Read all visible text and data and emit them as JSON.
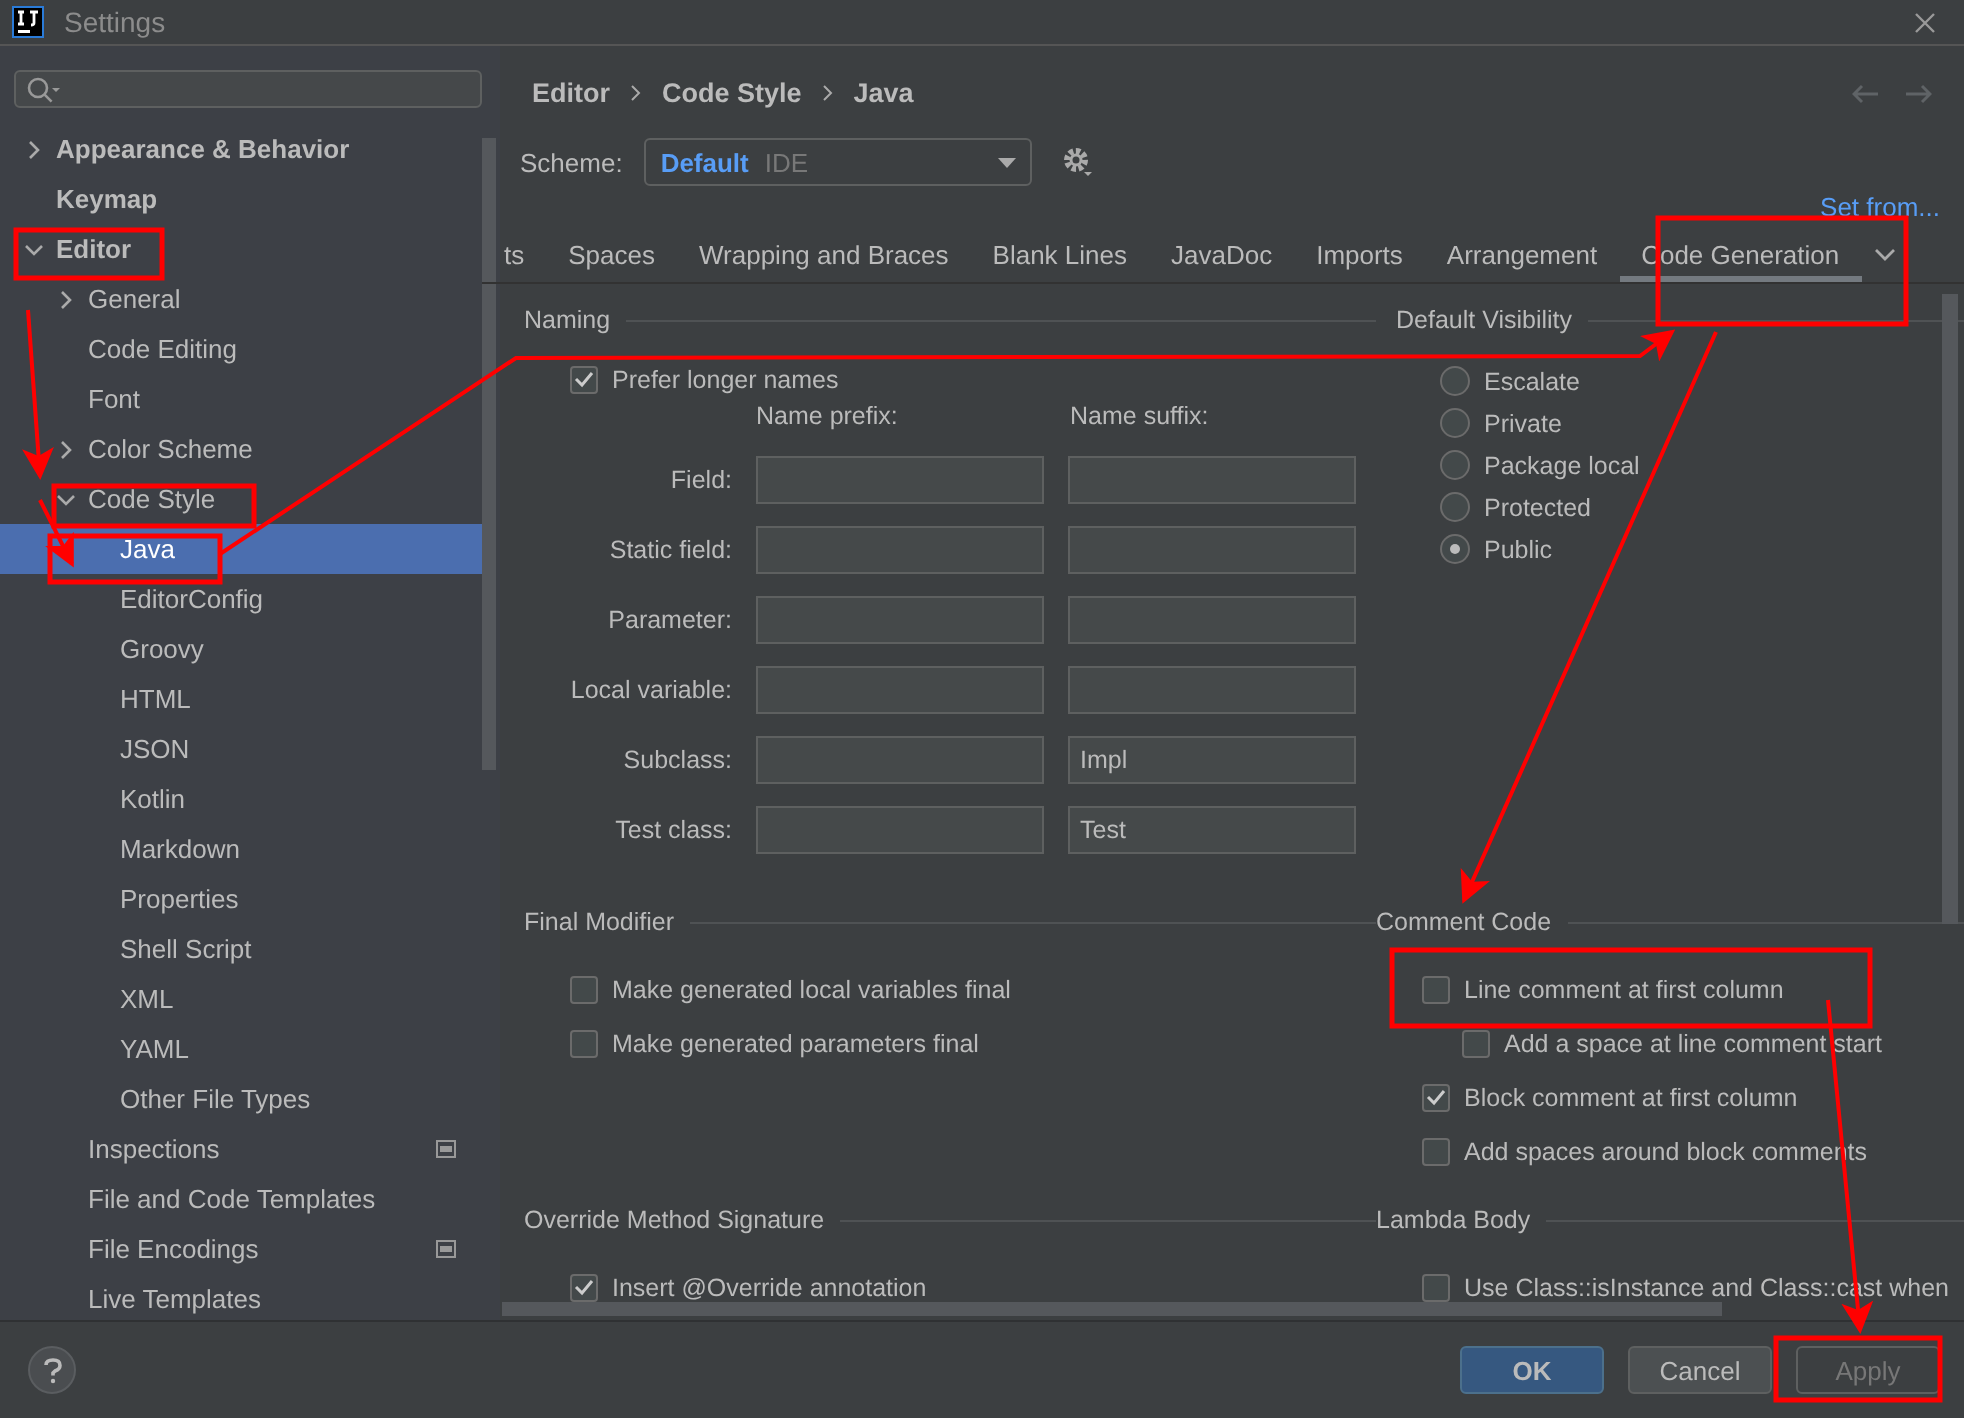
{
  "window": {
    "title": "Settings"
  },
  "sidebar": {
    "items": [
      {
        "label": "Appearance & Behavior",
        "bold": true,
        "expanded": false,
        "selected": false
      },
      {
        "label": "Keymap",
        "bold": true,
        "selected": false
      },
      {
        "label": "Editor",
        "bold": true,
        "expanded": true,
        "selected": false,
        "children": [
          {
            "label": "General",
            "expanded": false,
            "selected": false
          },
          {
            "label": "Code Editing",
            "selected": false
          },
          {
            "label": "Font",
            "selected": false
          },
          {
            "label": "Color Scheme",
            "expanded": false,
            "selected": false
          },
          {
            "label": "Code Style",
            "expanded": true,
            "selected": false,
            "children": [
              {
                "label": "Java",
                "selected": true
              },
              {
                "label": "EditorConfig",
                "selected": false
              },
              {
                "label": "Groovy",
                "selected": false
              },
              {
                "label": "HTML",
                "selected": false
              },
              {
                "label": "JSON",
                "selected": false
              },
              {
                "label": "Kotlin",
                "selected": false
              },
              {
                "label": "Markdown",
                "selected": false
              },
              {
                "label": "Properties",
                "selected": false
              },
              {
                "label": "Shell Script",
                "selected": false
              },
              {
                "label": "XML",
                "selected": false
              },
              {
                "label": "YAML",
                "selected": false
              },
              {
                "label": "Other File Types",
                "selected": false
              }
            ]
          },
          {
            "label": "Inspections",
            "selected": false,
            "scoped": true
          },
          {
            "label": "File and Code Templates",
            "selected": false
          },
          {
            "label": "File Encodings",
            "selected": false,
            "scoped": true
          },
          {
            "label": "Live Templates",
            "selected": false
          }
        ]
      }
    ]
  },
  "breadcrumb": [
    "Editor",
    "Code Style",
    "Java"
  ],
  "scheme": {
    "label": "Scheme:",
    "name": "Default",
    "scope": "IDE"
  },
  "set_from": "Set from...",
  "tabs": [
    {
      "label": "ts",
      "selected": false
    },
    {
      "label": "Spaces",
      "selected": false
    },
    {
      "label": "Wrapping and Braces",
      "selected": false
    },
    {
      "label": "Blank Lines",
      "selected": false
    },
    {
      "label": "JavaDoc",
      "selected": false
    },
    {
      "label": "Imports",
      "selected": false
    },
    {
      "label": "Arrangement",
      "selected": false
    },
    {
      "label": "Code Generation",
      "selected": true
    }
  ],
  "naming": {
    "title": "Naming",
    "prefer_longer": {
      "label": "Prefer longer names",
      "checked": true
    },
    "prefix_header": "Name prefix:",
    "suffix_header": "Name suffix:",
    "rows": [
      {
        "label": "Field:",
        "prefix": "",
        "suffix": ""
      },
      {
        "label": "Static field:",
        "prefix": "",
        "suffix": ""
      },
      {
        "label": "Parameter:",
        "prefix": "",
        "suffix": ""
      },
      {
        "label": "Local variable:",
        "prefix": "",
        "suffix": ""
      },
      {
        "label": "Subclass:",
        "prefix": "",
        "suffix": "Impl"
      },
      {
        "label": "Test class:",
        "prefix": "",
        "suffix": "Test"
      }
    ]
  },
  "default_visibility": {
    "title": "Default Visibility",
    "options": [
      {
        "label": "Escalate",
        "selected": false
      },
      {
        "label": "Private",
        "selected": false
      },
      {
        "label": "Package local",
        "selected": false
      },
      {
        "label": "Protected",
        "selected": false
      },
      {
        "label": "Public",
        "selected": true
      }
    ]
  },
  "final_modifier": {
    "title": "Final Modifier",
    "options": [
      {
        "label": "Make generated local variables final",
        "checked": false,
        "indented": false
      },
      {
        "label": "Make generated parameters final",
        "checked": false,
        "indented": false
      }
    ]
  },
  "comment_code": {
    "title": "Comment Code",
    "options": [
      {
        "label": "Line comment at first column",
        "checked": false,
        "indented": false
      },
      {
        "label": "Add a space at line comment start",
        "checked": false,
        "indented": true
      },
      {
        "label": "Block comment at first column",
        "checked": true,
        "indented": false
      },
      {
        "label": "Add spaces around block comments",
        "checked": false,
        "indented": false
      }
    ]
  },
  "override_signature": {
    "title": "Override Method Signature",
    "options": [
      {
        "label": "Insert @Override annotation",
        "checked": true,
        "indented": false
      }
    ]
  },
  "lambda_body": {
    "title": "Lambda Body",
    "options": [
      {
        "label": "Use Class::isInstance and Class::cast when",
        "checked": false,
        "indented": false
      }
    ]
  },
  "buttons": [
    {
      "label": "OK",
      "kind": "primary",
      "disabled": false
    },
    {
      "label": "Cancel",
      "kind": "normal",
      "disabled": false
    },
    {
      "label": "Apply",
      "kind": "normal",
      "disabled": true
    }
  ]
}
